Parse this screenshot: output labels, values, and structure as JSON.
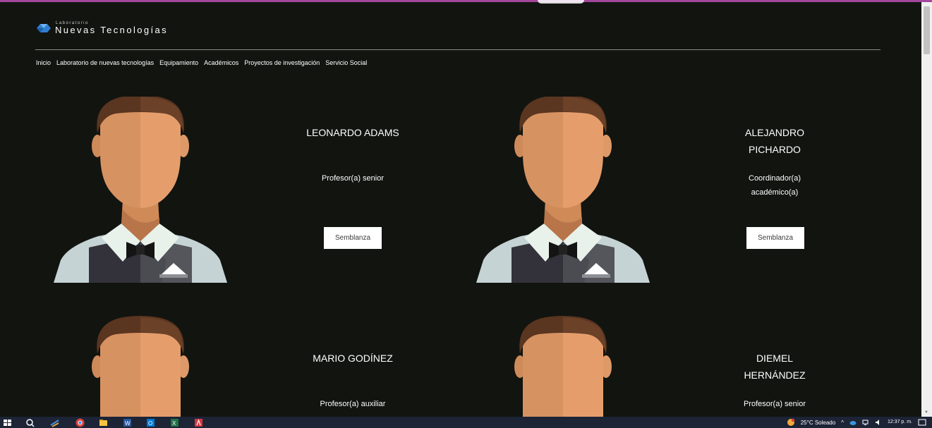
{
  "site": {
    "logo_small": "Laboratorio",
    "logo_big": "Nuevas Tecnologías"
  },
  "nav": [
    "Inicio",
    "Laboratorio de nuevas tecnologías",
    "Equipamiento",
    "Académicos",
    "Proyectos de investigación",
    "Servicio Social"
  ],
  "people": [
    {
      "name": "LEONARDO ADAMS",
      "role": "Profesor(a) senior",
      "button": "Semblanza"
    },
    {
      "name": "ALEJANDRO PICHARDO",
      "role": "Coordinador(a) académico(a)",
      "button": "Semblanza"
    },
    {
      "name": "MARIO GODÍNEZ",
      "role": "Profesor(a) auxiliar"
    },
    {
      "name": "DIEMEL HERNÁNDEZ",
      "role": "Profesor(a) senior"
    }
  ],
  "taskbar": {
    "weather": "25°C Soleado",
    "time": "12:37 p. m."
  },
  "colors": {
    "background": "#121410",
    "accent": "#a3469c",
    "taskbar": "#1c2436"
  }
}
